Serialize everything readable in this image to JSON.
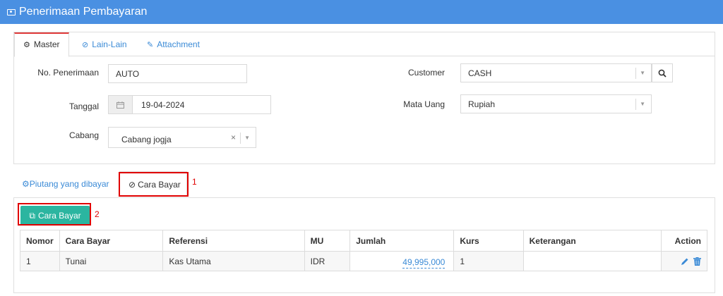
{
  "window": {
    "title": "Penerimaan Pembayaran",
    "icon": "money-icon"
  },
  "tabs": [
    {
      "label": "Master",
      "icon": "gears-icon",
      "active": true
    },
    {
      "label": "Lain-Lain",
      "icon": "check-circle-icon",
      "active": false
    },
    {
      "label": "Attachment",
      "icon": "paperclip-icon",
      "active": false
    }
  ],
  "form": {
    "no_penerimaan_label": "No. Penerimaan",
    "no_penerimaan_value": "AUTO",
    "tanggal_label": "Tanggal",
    "tanggal_value": "19-04-2024",
    "cabang_label": "Cabang",
    "cabang_value": "Cabang jogja",
    "customer_label": "Customer",
    "customer_value": "CASH",
    "mata_uang_label": "Mata Uang",
    "mata_uang_value": "Rupiah"
  },
  "sub_tabs": [
    {
      "label": "Piutang yang dibayar",
      "icon": "gears-icon",
      "active": false
    },
    {
      "label": "Cara Bayar",
      "icon": "check-circle-icon",
      "active": true
    }
  ],
  "annotations": [
    "1",
    "2"
  ],
  "add_button": {
    "label": "Cara Bayar",
    "icon": "copy-icon"
  },
  "table": {
    "headers": [
      "Nomor",
      "Cara Bayar",
      "Referensi",
      "MU",
      "Jumlah",
      "Kurs",
      "Keterangan",
      "Action"
    ],
    "rows": [
      {
        "nomor": "1",
        "cara_bayar": "Tunai",
        "referensi": "Kas Utama",
        "mu": "IDR",
        "jumlah": "49,995,000",
        "kurs": "1",
        "keterangan": ""
      }
    ]
  },
  "colors": {
    "title_bar": "#4a90e2",
    "accent": "#3a8ad6",
    "button": "#2bb5a0",
    "highlight": "#e00000"
  }
}
